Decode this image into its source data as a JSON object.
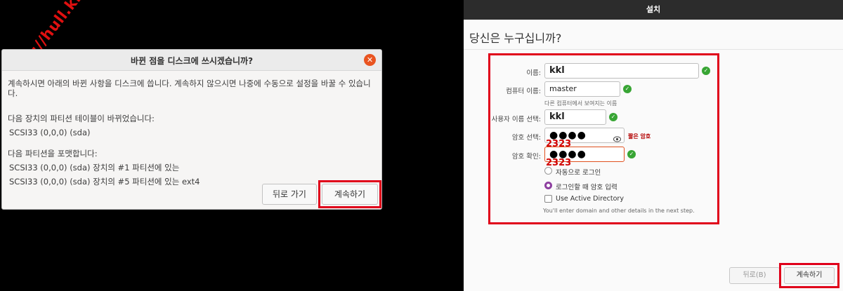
{
  "watermark": "http://hull.kr",
  "dialog": {
    "title": "바뀐 점을 디스크에 쓰시겠습니까?",
    "close_icon": "close-icon",
    "message": "계속하시면 아래의 바뀐 사항을 디스크에 씁니다. 계속하지 않으시면 나중에 수동으로 설정을 바꿀 수 있습니다.",
    "partition_table_heading": "다음 장치의 파티션 테이블이 바뀌었습니다:",
    "partition_table_device": "SCSI33 (0,0,0) (sda)",
    "format_heading": "다음 파티션을 포맷합니다:",
    "format_items": [
      "SCSI33 (0,0,0) (sda) 장치의 #1 파티션에 있는",
      "SCSI33 (0,0,0) (sda) 장치의 #5 파티션에 있는 ext4"
    ],
    "back_label": "뒤로 가기",
    "continue_label": "계속하기"
  },
  "installer": {
    "window_title": "설치",
    "heading": "당신은 누구십니까?",
    "name_label": "이름:",
    "name_value": "kkl",
    "computer_label": "컴퓨터 이름:",
    "computer_value": "master",
    "computer_hint": "다른 컴퓨터에서 보여지는 이름",
    "username_label": "사용자 이름 선택:",
    "username_value": "kkl",
    "password_label": "암호 선택:",
    "password_value": "●●●●",
    "password_strength": "짧은 암호",
    "password_note": "2323",
    "confirm_label": "암호 확인:",
    "confirm_value": "●●●●",
    "confirm_note": "2323",
    "auto_login_label": "자동으로 로그인",
    "require_password_label": "로그인할 때 암호 입력",
    "active_directory_label": "Use Active Directory",
    "active_directory_hint": "You'll enter domain and other details in the next step.",
    "back_label": "뒤로(B)",
    "continue_label": "계속하기",
    "colors": {
      "ok": "#38a534",
      "accent": "#e95420",
      "radio": "#8e3fa0",
      "highlight": "#e0001a"
    }
  }
}
